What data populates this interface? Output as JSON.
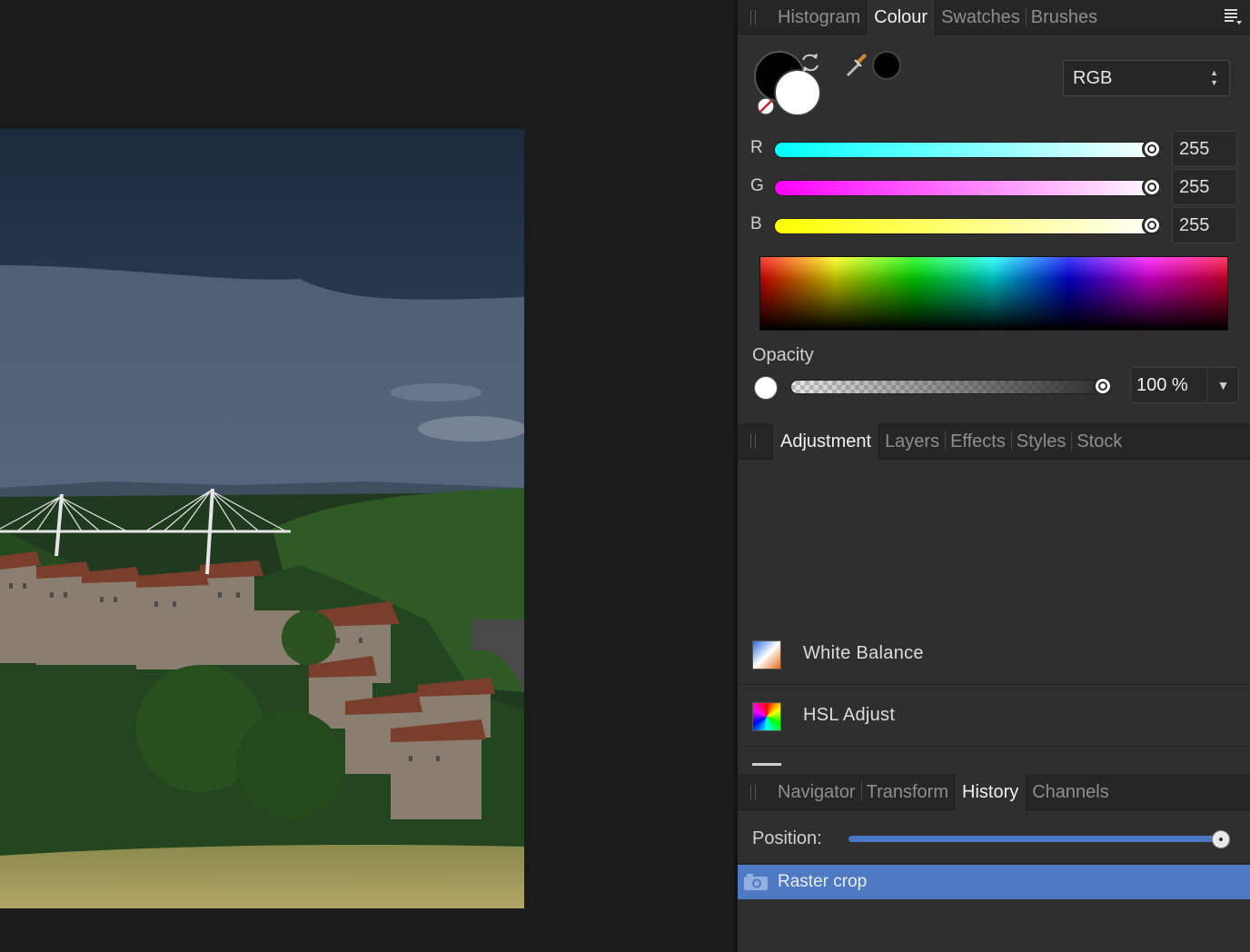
{
  "colour_tabs": [
    "Histogram",
    "Colour",
    "Swatches",
    "Brushes"
  ],
  "colour_tabs_active": "Colour",
  "colour": {
    "mode": "RGB",
    "channels": [
      {
        "label": "R",
        "value": "255",
        "gradient_from": "#00ffff",
        "gradient_to": "#ffffff",
        "level": 1.0
      },
      {
        "label": "G",
        "value": "255",
        "gradient_from": "#ff00ff",
        "gradient_to": "#ffffff",
        "level": 1.0
      },
      {
        "label": "B",
        "value": "255",
        "gradient_from": "#ffff00",
        "gradient_to": "#ffffff",
        "level": 1.0
      }
    ],
    "primary_color": "#000000",
    "secondary_color": "#ffffff",
    "opacity_label": "Opacity",
    "opacity_value": "100 %",
    "opacity_level": 1.0
  },
  "adjust_tabs": [
    "Adjustment",
    "Layers",
    "Effects",
    "Styles",
    "Stock"
  ],
  "adjust_tabs_active": "Adjustment",
  "adjustments": [
    {
      "label": "White Balance",
      "icon": "white-balance-icon"
    },
    {
      "label": "HSL Adjust",
      "icon": "hsl-adjust-icon"
    }
  ],
  "history_tabs": [
    "Navigator",
    "Transform",
    "History",
    "Channels"
  ],
  "history_tabs_active": "History",
  "history": {
    "position_label": "Position:",
    "position_level": 1.0,
    "items": [
      {
        "label": "Raster crop",
        "icon": "camera-icon"
      }
    ]
  },
  "theme": {
    "selection_blue": "#4f79c0",
    "panel_bg": "#2f2f2f"
  }
}
